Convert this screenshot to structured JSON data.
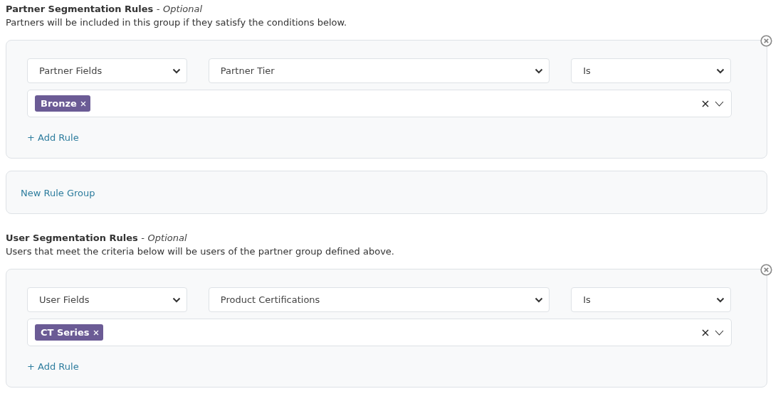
{
  "sections": [
    {
      "title": "Partner Segmentation Rules",
      "separator": "-",
      "optional": "Optional",
      "description": "Partners will be included in this group if they satisfy the conditions below.",
      "rule_groups": [
        {
          "rules": [
            {
              "field_type": "Partner Fields",
              "field": "Partner Tier",
              "operator": "Is",
              "values": [
                "Bronze"
              ]
            }
          ],
          "add_rule": "+ Add Rule"
        }
      ],
      "new_rule_group": "New Rule Group"
    },
    {
      "title": "User Segmentation Rules",
      "separator": "-",
      "optional": "Optional",
      "description": "Users that meet the criteria below will be users of the partner group defined above.",
      "rule_groups": [
        {
          "rules": [
            {
              "field_type": "User Fields",
              "field": "Product Certifications",
              "operator": "Is",
              "values": [
                "CT Series"
              ]
            }
          ],
          "add_rule": "+ Add Rule"
        }
      ]
    }
  ]
}
